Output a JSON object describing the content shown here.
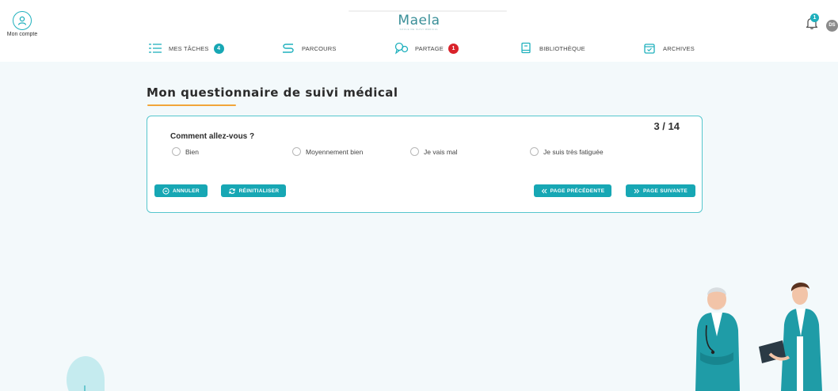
{
  "header": {
    "account_label": "Mon compte",
    "logo_text": "Maela",
    "logo_tagline": "SOCLE DE SUIVI MÉDICAL",
    "notification_count": "1",
    "user_initials": "DS"
  },
  "nav": {
    "items": [
      {
        "label": "MES TÂCHES",
        "badge": "4",
        "icon": "list-icon",
        "badge_color": "#17a7b4"
      },
      {
        "label": "PARCOURS",
        "badge": "",
        "icon": "route-icon"
      },
      {
        "label": "PARTAGE",
        "badge": "1",
        "icon": "share-icon",
        "badge_color": "#d9222a"
      },
      {
        "label": "BIBLIOTHÈQUE",
        "badge": "",
        "icon": "book-icon"
      },
      {
        "label": "ARCHIVES",
        "badge": "",
        "icon": "archive-icon"
      }
    ]
  },
  "page": {
    "title": "Mon questionnaire de suivi médical"
  },
  "questionnaire": {
    "counter": "3 / 14",
    "question": "Comment allez-vous ?",
    "options": [
      "Bien",
      "Moyennement bien",
      "Je vais mal",
      "Je suis très fatiguée"
    ],
    "selected": null
  },
  "buttons": {
    "cancel": "ANNULER",
    "reset": "RÉINITIALISER",
    "previous": "PAGE PRÉCÉDENTE",
    "next": "PAGE SUIVANTE"
  },
  "colors": {
    "accent": "#17a7b4",
    "title_underline": "#f1a63a",
    "card_border": "#55c6cd",
    "background": "#f3f9fb"
  }
}
